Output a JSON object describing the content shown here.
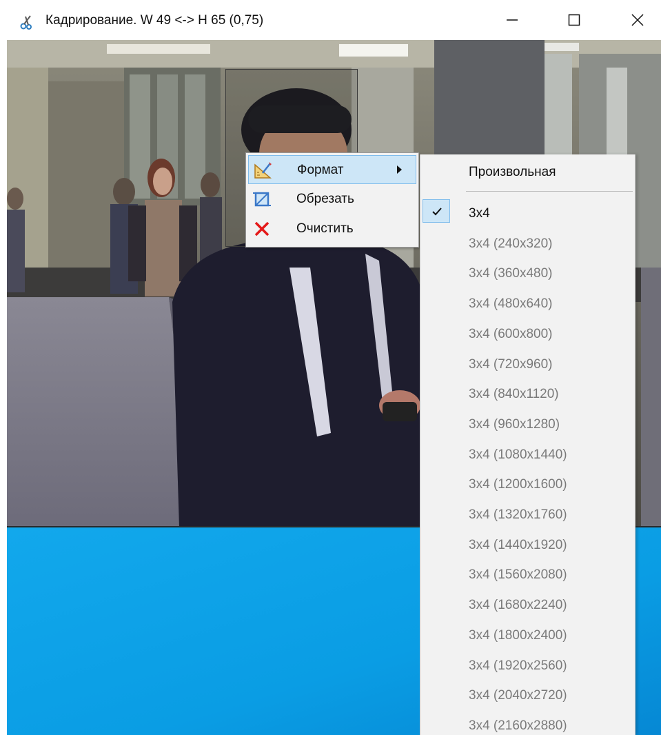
{
  "window": {
    "title": "Кадрирование. W 49 <-> H 65 (0,75)",
    "icon": "scissors-icon",
    "controls": [
      "minimize-icon",
      "maximize-icon",
      "close-icon"
    ]
  },
  "context_menu": {
    "items": [
      {
        "label": "Формат",
        "icon": "format-ruler-icon",
        "has_submenu": true,
        "highlighted": true
      },
      {
        "label": "Обрезать",
        "icon": "crop-icon",
        "has_submenu": false,
        "highlighted": false
      },
      {
        "label": "Очистить",
        "icon": "clear-x-icon",
        "has_submenu": false,
        "highlighted": false
      }
    ]
  },
  "submenu": {
    "custom_label": "Произвольная",
    "items": [
      {
        "label": "3x4",
        "checked": true,
        "enabled": true
      },
      {
        "label": "3x4 (240x320)",
        "checked": false,
        "enabled": false
      },
      {
        "label": "3x4 (360x480)",
        "checked": false,
        "enabled": false
      },
      {
        "label": "3x4 (480x640)",
        "checked": false,
        "enabled": false
      },
      {
        "label": "3x4 (600x800)",
        "checked": false,
        "enabled": false
      },
      {
        "label": "3x4 (720x960)",
        "checked": false,
        "enabled": false
      },
      {
        "label": "3x4 (840x1120)",
        "checked": false,
        "enabled": false
      },
      {
        "label": "3x4 (960x1280)",
        "checked": false,
        "enabled": false
      },
      {
        "label": "3x4 (1080x1440)",
        "checked": false,
        "enabled": false
      },
      {
        "label": "3x4 (1200x1600)",
        "checked": false,
        "enabled": false
      },
      {
        "label": "3x4 (1320x1760)",
        "checked": false,
        "enabled": false
      },
      {
        "label": "3x4 (1440x1920)",
        "checked": false,
        "enabled": false
      },
      {
        "label": "3x4 (1560x2080)",
        "checked": false,
        "enabled": false
      },
      {
        "label": "3x4 (1680x2240)",
        "checked": false,
        "enabled": false
      },
      {
        "label": "3x4 (1800x2400)",
        "checked": false,
        "enabled": false
      },
      {
        "label": "3x4 (1920x2560)",
        "checked": false,
        "enabled": false
      },
      {
        "label": "3x4 (2040x2720)",
        "checked": false,
        "enabled": false
      },
      {
        "label": "3x4 (2160x2880)",
        "checked": false,
        "enabled": false
      }
    ]
  },
  "colors": {
    "menu_bg": "#f2f2f2",
    "highlight_bg": "#cde6f7",
    "highlight_border": "#7fbcec",
    "disabled_text": "#7a7a7a",
    "desktop_blue": "#0aa0e6"
  }
}
